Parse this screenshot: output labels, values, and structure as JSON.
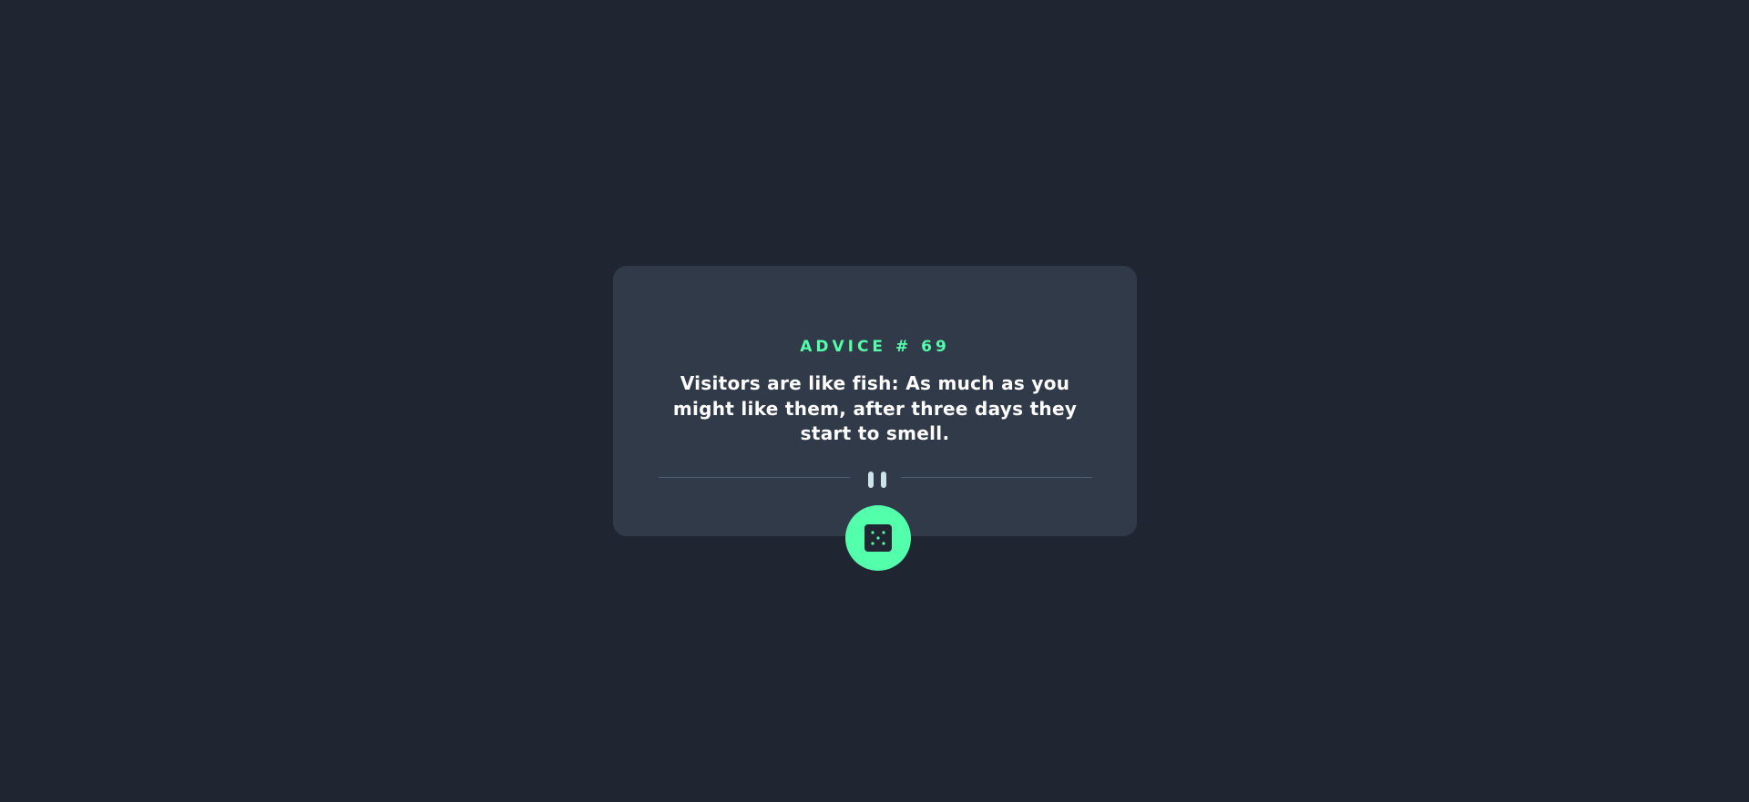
{
  "advice": {
    "id_label": "ADVICE # 69",
    "text": "Visitors are like fish: As much as you might like them, after three days they start to smell."
  },
  "divider": {
    "icon": "pause-icon"
  },
  "button": {
    "icon": "dice-icon"
  },
  "colors": {
    "background": "#1f2632",
    "card": "#313a48",
    "accent": "#53ffaa",
    "text": "#ffffff",
    "divider_line": "#4f5d74",
    "divider_icon": "#cee3e9"
  }
}
